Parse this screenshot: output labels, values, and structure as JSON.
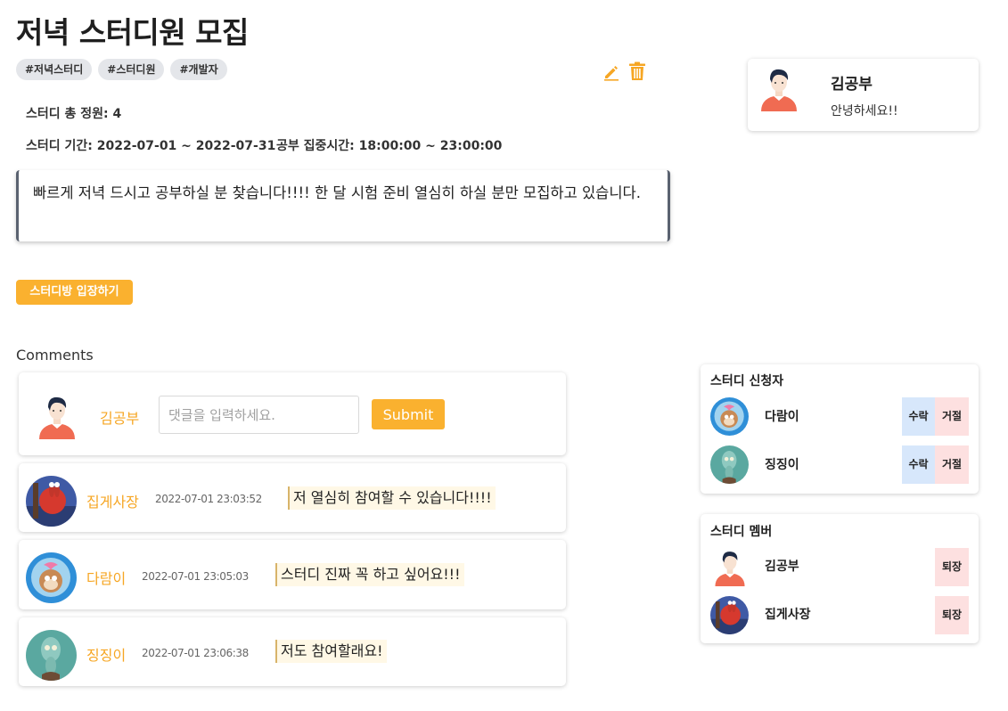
{
  "post": {
    "title": "저녁 스터디원 모집",
    "tags": [
      "#저녁스터디",
      "#스터디원",
      "#개발자"
    ],
    "capacity": "스터디 총 정원: 4",
    "period": "스터디 기간: 2022-07-01 ~ 2022-07-31",
    "focus_time": "공부 집중시간: 18:00:00 ~ 23:00:00",
    "description": "빠르게 저녁 드시고 공부하실 분 찾습니다!!!! 한 달 시험 준비 열심히 하실 분만 모집하고 있습니다.",
    "enter_label": "스터디방 입장하기",
    "edit_icon": "pencil-icon",
    "delete_icon": "trash-icon"
  },
  "profile": {
    "name": "김공부",
    "greeting": "안녕하세요!!"
  },
  "comments": {
    "label": "Comments",
    "current_user": "김공부",
    "input_placeholder": "댓글을 입력하세요.",
    "submit_label": "Submit",
    "items": [
      {
        "author": "집게사장",
        "time": "2022-07-01 23:03:52",
        "text": "저 열심히 참여할 수 있습니다!!!!"
      },
      {
        "author": "다람이",
        "time": "2022-07-01 23:05:03",
        "text": "스터디 진짜 꼭 하고 싶어요!!!"
      },
      {
        "author": "징징이",
        "time": "2022-07-01 23:06:38",
        "text": "저도 참여할래요!"
      }
    ]
  },
  "applicants": {
    "title": "스터디 신청자",
    "accept_label": "수락",
    "reject_label": "거절",
    "items": [
      {
        "name": "다람이"
      },
      {
        "name": "징징이"
      }
    ]
  },
  "members": {
    "title": "스터디 멤버",
    "kick_label": "퇴장",
    "items": [
      {
        "name": "김공부"
      },
      {
        "name": "집게사장"
      }
    ]
  },
  "colors": {
    "accent": "#fab12f",
    "author": "#f6a623",
    "accept_bg": "#d7e7fb",
    "reject_bg": "#fde0e0"
  }
}
